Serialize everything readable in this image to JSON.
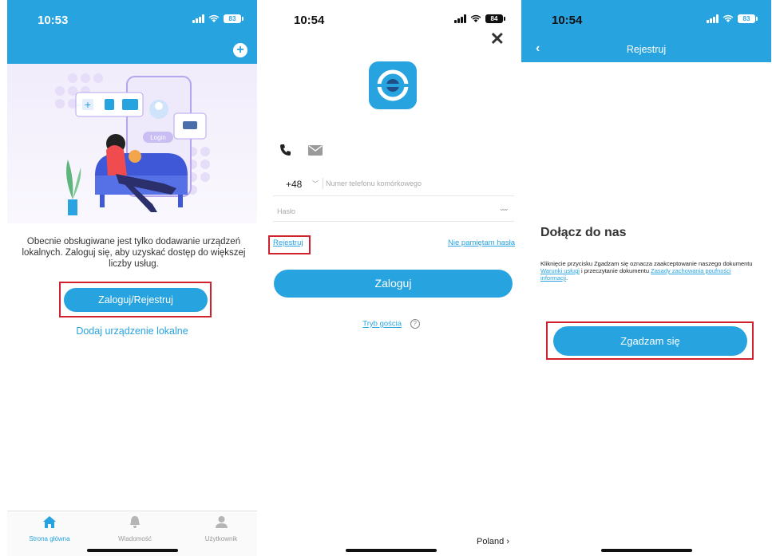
{
  "screen1": {
    "time": "10:53",
    "battery": "83",
    "hero_badge": "Login",
    "description": "Obecnie obsługiwane jest tylko dodawanie urządzeń lokalnych. Zaloguj się, aby uzyskać dostęp do większej liczby usług.",
    "login_register_button": "Zaloguj/Rejestruj",
    "add_local_device_link": "Dodaj urządzenie lokalne",
    "tabs": [
      {
        "label": "Strona główna",
        "icon": "home-icon"
      },
      {
        "label": "Wiadomość",
        "icon": "bell-icon"
      },
      {
        "label": "Użytkownik",
        "icon": "user-icon"
      }
    ]
  },
  "screen2": {
    "time": "10:54",
    "battery": "84",
    "country_code": "+48",
    "phone_placeholder": "Numer telefonu komórkowego",
    "password_placeholder": "Hasło",
    "register_link": "Rejestruj",
    "forgot_password_link": "Nie pamiętam hasła",
    "login_button": "Zaloguj",
    "guest_mode_link": "Tryb gościa",
    "region": "Poland"
  },
  "screen3": {
    "time": "10:54",
    "battery": "83",
    "title": "Rejestruj",
    "heading": "Dołącz do nas",
    "terms_prefix": "Kliknięcie przycisku Zgadzam się oznacza zaakceptowanie naszego dokumentu ",
    "terms_link": "Warunki usługi",
    "terms_middle": " i przeczytanie dokumentu ",
    "privacy_link": "Zasady zachowania poufności informacji",
    "terms_suffix": ".",
    "agree_button": "Zgadzam się"
  },
  "colors": {
    "accent": "#27a3e0",
    "highlight": "#d0212f"
  }
}
